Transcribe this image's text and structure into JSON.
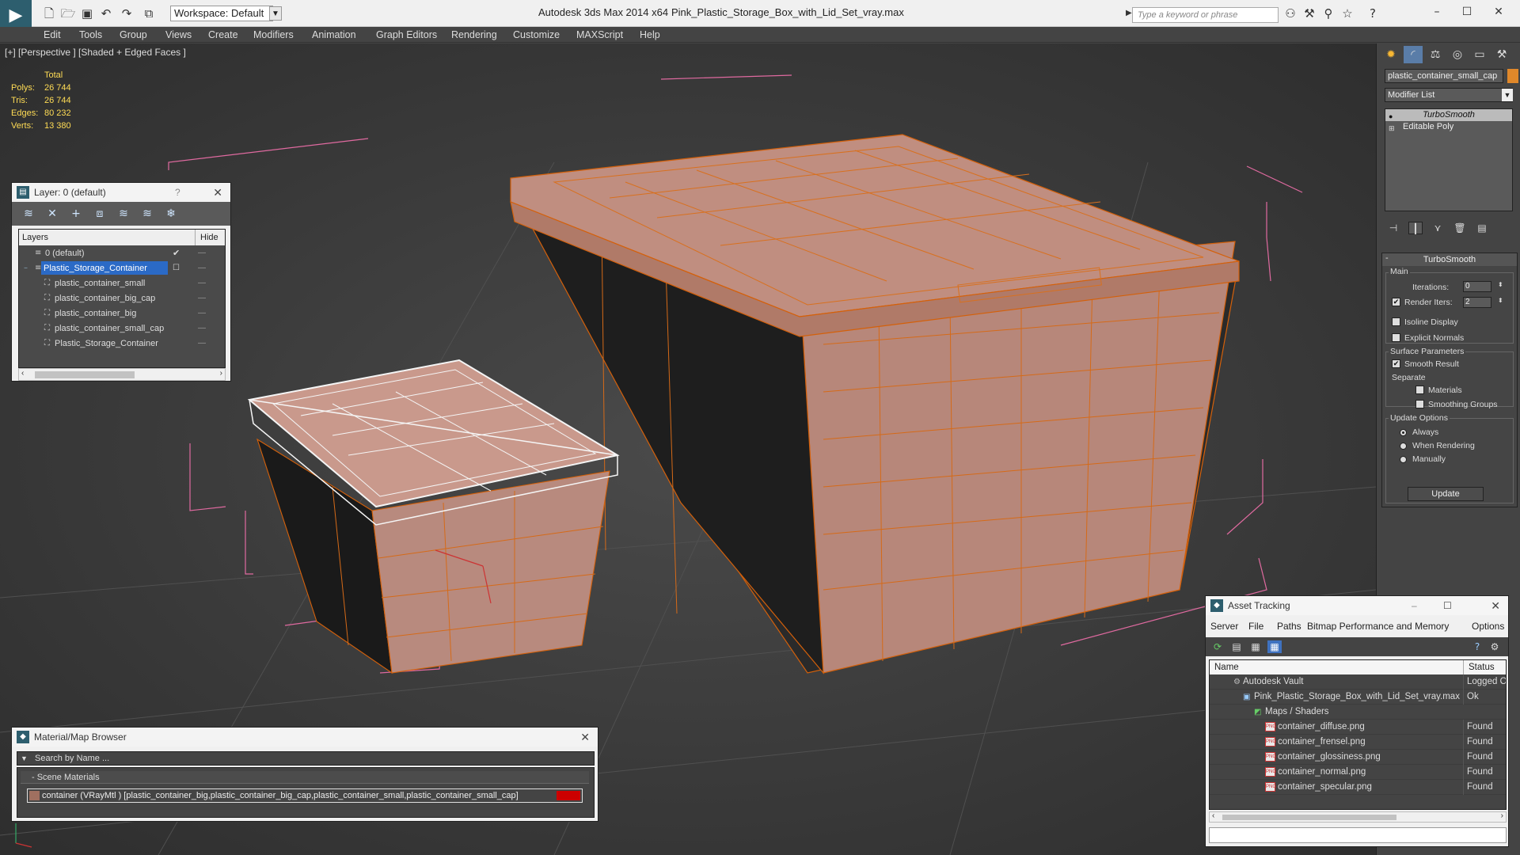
{
  "titlebar": {
    "app_title": "Autodesk 3ds Max  2014 x64",
    "file_title": "Pink_Plastic_Storage_Box_with_Lid_Set_vray.max",
    "workspace": "Workspace: Default",
    "search_placeholder": "Type a keyword or phrase"
  },
  "menu": [
    "Edit",
    "Tools",
    "Group",
    "Views",
    "Create",
    "Modifiers",
    "Animation",
    "Graph Editors",
    "Rendering",
    "Customize",
    "MAXScript",
    "Help"
  ],
  "viewport": {
    "label": "[+] [Perspective ] [Shaded + Edged Faces ]",
    "stats": {
      "header": "Total",
      "rows": [
        {
          "label": "Polys:",
          "value": "26 744"
        },
        {
          "label": "Tris:",
          "value": "26 744"
        },
        {
          "label": "Edges:",
          "value": "80 232"
        },
        {
          "label": "Verts:",
          "value": "13 380"
        }
      ]
    }
  },
  "layer_panel": {
    "title": "Layer: 0 (default)",
    "help": "?",
    "col_layers": "Layers",
    "col_hide": "Hide",
    "layers": [
      {
        "name": "0 (default)",
        "level": 0
      },
      {
        "name": "Plastic_Storage_Container",
        "level": 0,
        "selected": true
      },
      {
        "name": "plastic_container_small",
        "level": 1
      },
      {
        "name": "plastic_container_big_cap",
        "level": 1
      },
      {
        "name": "plastic_container_big",
        "level": 1
      },
      {
        "name": "plastic_container_small_cap",
        "level": 1
      },
      {
        "name": "Plastic_Storage_Container",
        "level": 1
      }
    ]
  },
  "command_panel": {
    "object_name": "plastic_container_small_cap",
    "object_color": "#e0882a",
    "modifier_list": "Modifier List",
    "stack": [
      "TurboSmooth",
      "Editable Poly"
    ],
    "rollout": {
      "title": "TurboSmooth",
      "main_label": "Main",
      "iterations_label": "Iterations:",
      "iterations_value": "0",
      "render_iters_label": "Render Iters:",
      "render_iters_value": "2",
      "isoline": "Isoline Display",
      "explicit_normals": "Explicit Normals",
      "surface_label": "Surface Parameters",
      "smooth_result": "Smooth Result",
      "separate": "Separate",
      "materials": "Materials",
      "smoothing_groups": "Smoothing Groups",
      "update_options": "Update Options",
      "always": "Always",
      "when_rendering": "When Rendering",
      "manually": "Manually",
      "update_button": "Update"
    }
  },
  "material_browser": {
    "title": "Material/Map Browser",
    "search": "Search by Name ...",
    "group": "- Scene Materials",
    "item": "container  (VRayMtl ) [plastic_container_big,plastic_container_big_cap,plastic_container_small,plastic_container_small_cap]"
  },
  "asset_tracking": {
    "title": "Asset Tracking",
    "menu": [
      "Server",
      "File",
      "Paths",
      "Bitmap Performance and Memory",
      "Options"
    ],
    "col_name": "Name",
    "col_status": "Status",
    "rows": [
      {
        "name": "Autodesk Vault",
        "status": "Logged O",
        "indent": 0
      },
      {
        "name": "Pink_Plastic_Storage_Box_with_Lid_Set_vray.max",
        "status": "Ok",
        "indent": 1
      },
      {
        "name": "Maps / Shaders",
        "status": "",
        "indent": 2
      },
      {
        "name": "container_diffuse.png",
        "status": "Found",
        "indent": 3
      },
      {
        "name": "container_frensel.png",
        "status": "Found",
        "indent": 3
      },
      {
        "name": "container_glossiness.png",
        "status": "Found",
        "indent": 3
      },
      {
        "name": "container_normal.png",
        "status": "Found",
        "indent": 3
      },
      {
        "name": "container_specular.png",
        "status": "Found",
        "indent": 3
      }
    ]
  }
}
